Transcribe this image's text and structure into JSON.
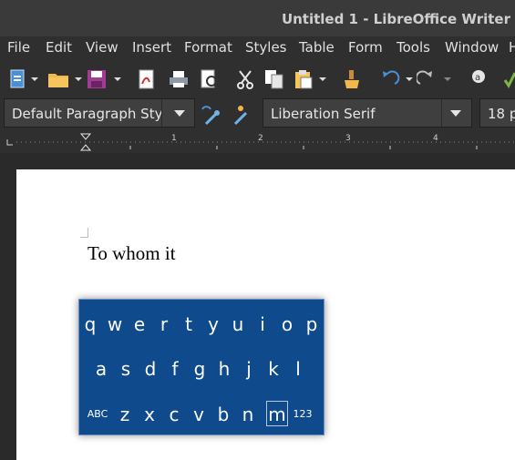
{
  "window": {
    "title": "Untitled 1 - LibreOffice Writer"
  },
  "menubar": {
    "items": [
      "File",
      "Edit",
      "View",
      "Insert",
      "Format",
      "Styles",
      "Table",
      "Form",
      "Tools",
      "Window",
      "H"
    ]
  },
  "toolbar": {
    "icons": [
      "new-document-icon",
      "open-folder-icon",
      "save-icon",
      "export-pdf-icon",
      "print-icon",
      "print-preview-icon",
      "cut-icon",
      "copy-icon",
      "paste-icon",
      "clone-formatting-icon",
      "undo-icon",
      "redo-icon",
      "spelling-icon"
    ]
  },
  "format": {
    "paragraph_style": "Default Paragraph Sty",
    "font_name": "Liberation Serif",
    "font_size": "18 p"
  },
  "ruler": {
    "numbers": [
      "1",
      "2",
      "3",
      "4"
    ]
  },
  "document": {
    "text": "To whom it"
  },
  "keyboard": {
    "row1": [
      "q",
      "w",
      "e",
      "r",
      "t",
      "y",
      "u",
      "i",
      "o",
      "p"
    ],
    "row2": [
      "a",
      "s",
      "d",
      "f",
      "g",
      "h",
      "j",
      "k",
      "l"
    ],
    "row3": [
      "ABC",
      "z",
      "x",
      "c",
      "v",
      "b",
      "n",
      "m",
      "123"
    ],
    "selected": "m"
  },
  "colors": {
    "keyboard_bg": "#0e4a8c",
    "titlebar_bg": "#3a3a3a",
    "toolbar_bg": "#2f2f2f"
  }
}
